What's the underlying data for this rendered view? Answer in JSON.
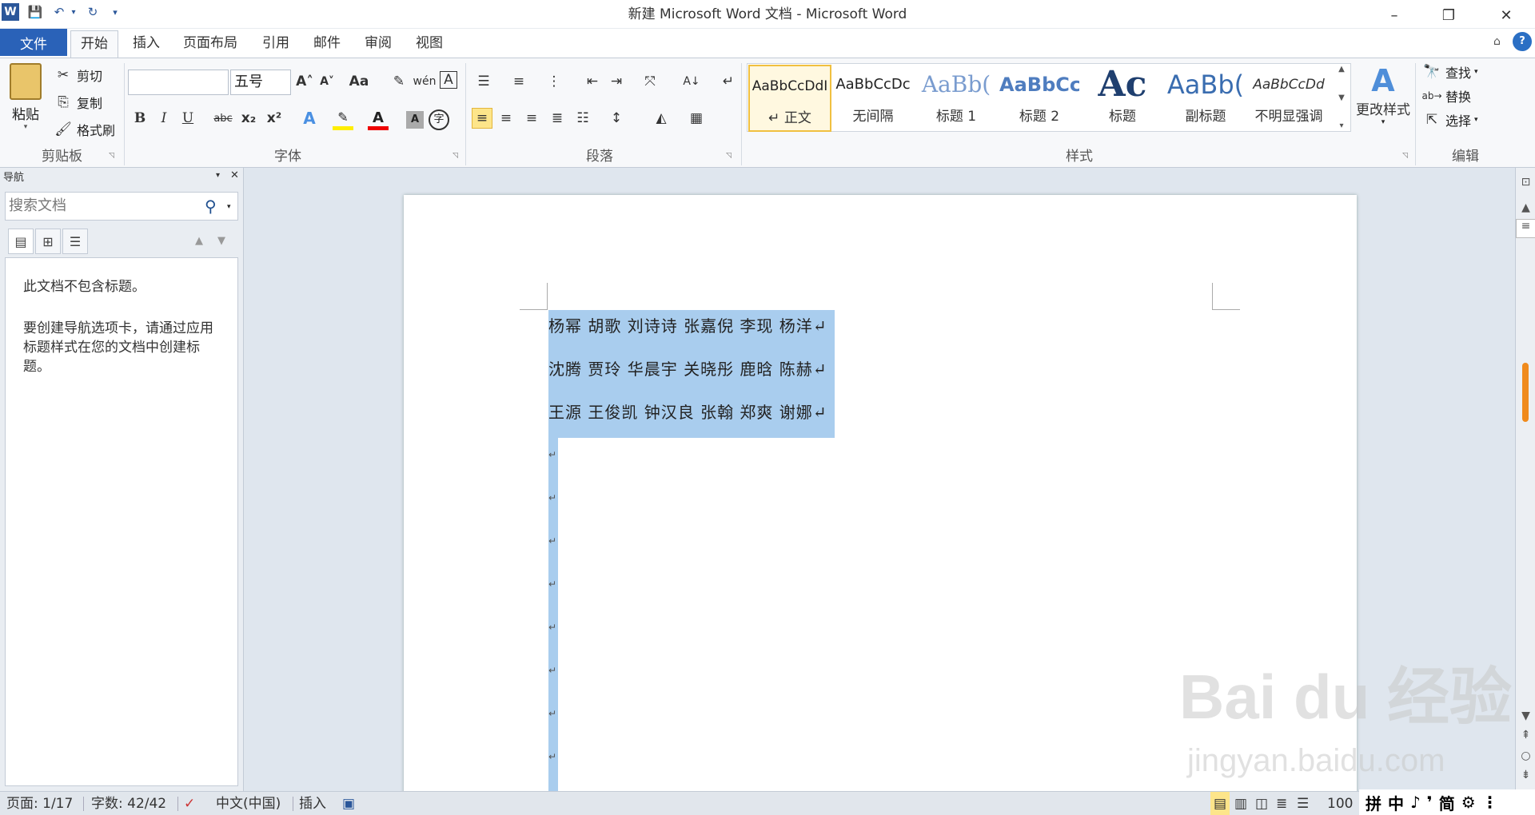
{
  "window": {
    "title": "新建 Microsoft Word 文档 - Microsoft Word",
    "minimize": "–",
    "restore": "❐",
    "close": "✕"
  },
  "quick_access": {
    "word_icon": "W",
    "save": "💾",
    "undo": "↶",
    "redo": "↻",
    "more": "▾"
  },
  "tabs": [
    {
      "label": "文件"
    },
    {
      "label": "开始"
    },
    {
      "label": "插入"
    },
    {
      "label": "页面布局"
    },
    {
      "label": "引用"
    },
    {
      "label": "邮件"
    },
    {
      "label": "审阅"
    },
    {
      "label": "视图"
    }
  ],
  "ribbon": {
    "clipboard": {
      "paste": "粘贴",
      "cut": "剪切",
      "copy": "复制",
      "format_painter": "格式刷",
      "label": "剪贴板"
    },
    "font": {
      "font_name": "",
      "font_size": "五号",
      "label": "字体",
      "bold": "B",
      "italic": "I",
      "underline": "U",
      "strike": "abc",
      "sub": "x₂",
      "sup": "x²"
    },
    "paragraph": {
      "label": "段落"
    },
    "styles": {
      "label": "样式",
      "items": [
        {
          "sample": "AaBbCcDdI",
          "name": "↵ 正文"
        },
        {
          "sample": "AaBbCcDc",
          "name": "无间隔"
        },
        {
          "sample": "AaBb(",
          "name": "标题 1"
        },
        {
          "sample": "AaBbCc",
          "name": "标题 2"
        },
        {
          "sample": "Ac",
          "name": "标题"
        },
        {
          "sample": "AaBb(",
          "name": "副标题"
        },
        {
          "sample": "AaBbCcDd",
          "name": "不明显强调"
        }
      ],
      "change_styles": "更改样式"
    },
    "editing": {
      "find": "查找",
      "replace": "替换",
      "select": "选择",
      "label": "编辑"
    }
  },
  "nav": {
    "title": "导航",
    "search_placeholder": "搜索文档",
    "message1": "此文档不包含标题。",
    "message2": "要创建导航选项卡，请通过应用标题样式在您的文档中创建标题。"
  },
  "document": {
    "lines": [
      "杨幂  胡歌  刘诗诗  张嘉倪  李现  杨洋↵",
      "沈腾  贾玲  华晨宇  关晓彤  鹿晗  陈赫↵",
      "王源  王俊凯  钟汉良  张翰  郑爽  谢娜↵"
    ],
    "para_mark": "↵"
  },
  "status": {
    "page": "页面: 1/17",
    "words": "字数: 42/42",
    "language": "中文(中国)",
    "mode": "插入",
    "zoom": "100"
  },
  "ime": {
    "items": [
      "拼",
      "中",
      "♪",
      "❜",
      "简",
      "⚙",
      "⋮"
    ]
  },
  "watermark": {
    "brand": "Bai du 经验",
    "url": "jingyan.baidu.com"
  }
}
